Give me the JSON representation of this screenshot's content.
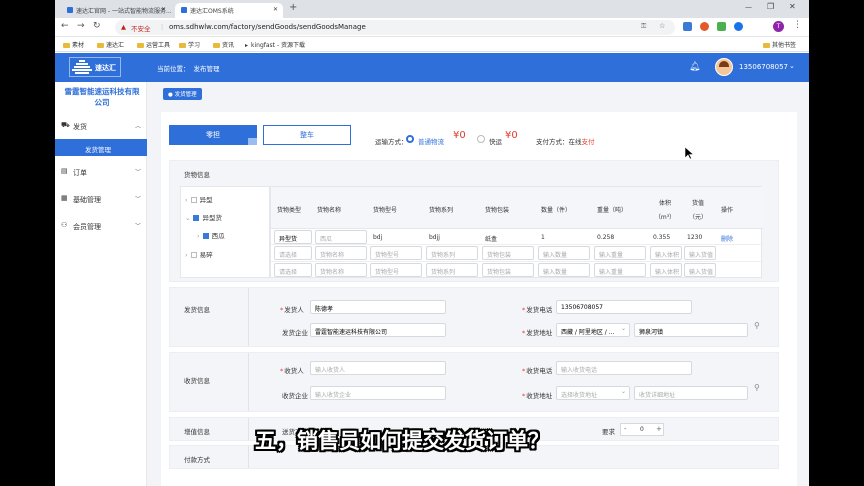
{
  "browser": {
    "tabs": [
      {
        "label": "速达汇官网 - 一站式智能物流服务..."
      },
      {
        "label": "速达汇OMS系统"
      }
    ],
    "insecure_label": "不安全",
    "url": "oms.sdhwlw.com/factory/sendGoods/sendGoodsManage",
    "bookmarks": [
      "素材",
      "速达汇",
      "运营工具",
      "学习",
      "资讯",
      "kingfast - 资源下载"
    ],
    "other_bookmarks": "其他书签"
  },
  "header": {
    "logo_text": "速达汇",
    "breadcrumb_prefix": "当前位置：",
    "breadcrumb_current": "发布管理",
    "phone": "13506708057"
  },
  "sidebar": {
    "company": "雷霆智能速运科技有限公司",
    "items": [
      {
        "label": "发货",
        "sub": "发货管理"
      },
      {
        "label": "订单"
      },
      {
        "label": "基础管理"
      },
      {
        "label": "会员管理"
      }
    ]
  },
  "page": {
    "tag": "发货管理",
    "mode_tabs": [
      "零担",
      "整车"
    ],
    "transport_label": "运输方式：",
    "transport_options": [
      {
        "label": "普通物流",
        "price": "¥0",
        "selected": true
      },
      {
        "label": "快运",
        "price": "¥0",
        "selected": false
      }
    ],
    "pay_label": "支付方式：在线",
    "pay_value": "支付"
  },
  "cargo": {
    "title": "货物信息",
    "tree": [
      {
        "label": "异型",
        "checked": false,
        "level": 0
      },
      {
        "label": "异型货",
        "checked": true,
        "level": 0
      },
      {
        "label": "西瓜",
        "checked": true,
        "level": 1
      },
      {
        "label": "易碎",
        "checked": false,
        "level": 0
      }
    ],
    "headers": [
      "货物类型",
      "货物名称",
      "货物型号",
      "货物系列",
      "货物包装",
      "数量（件）",
      "重量（吨）",
      "体积（m³）",
      "货值（元）",
      "操作"
    ],
    "row": {
      "type": "异型货",
      "name": "西瓜",
      "model": "bdj",
      "series": "bdjj",
      "pack": "纸盒",
      "qty": "1",
      "weight": "0.258",
      "volume": "0.355",
      "value": "1230",
      "op": "删除"
    },
    "empty_row": {
      "type": "请选择",
      "name": "货物名称",
      "model": "货物型号",
      "series": "货物系列",
      "pack": "货物包装",
      "qty": "输入数量",
      "weight": "输入重量",
      "volume": "输入体积",
      "value": "输入货值"
    }
  },
  "sender": {
    "title": "发货信息",
    "person_label": "发货人",
    "person": "陈德孝",
    "phone_label": "发货电话",
    "phone": "13506708057",
    "company_label": "发货企业",
    "company": "雷霆智能速运科技有限公司",
    "address_label": "发货地址",
    "region": "西藏 / 阿里地区 / ...",
    "street": "狮泉河镇"
  },
  "receiver": {
    "title": "收货信息",
    "person_label": "收货人",
    "person_ph": "输入收货人",
    "phone_label": "收货电话",
    "phone_ph": "输入收货电话",
    "company_label": "收货企业",
    "company_ph": "输入收货企业",
    "address_label": "收货地址",
    "region_ph": "选择收货地址",
    "street_ph": "收货详细地址"
  },
  "value_added": {
    "title": "增值信息",
    "field_label": "送货方式",
    "stepper_label": "要求",
    "stepper_value": "0",
    "minus": "-",
    "plus": "+"
  },
  "payment": {
    "title": "付款方式"
  },
  "subtitle": "五，销售员如何提交发货订单？",
  "colors": {
    "brand": "#2f6fd9",
    "accent_red": "#e23c2c",
    "link": "#2f6fd9"
  }
}
